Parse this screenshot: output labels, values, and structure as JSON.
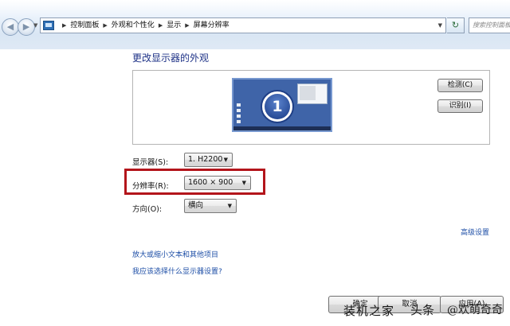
{
  "address_bar": {
    "back_icon": "back-arrow",
    "forward_icon": "forward-arrow",
    "breadcrumbs": [
      "控制面板",
      "外观和个性化",
      "显示",
      "屏幕分辨率"
    ],
    "search_placeholder": "搜索控制面板"
  },
  "main": {
    "title": "更改显示器的外观",
    "preview": {
      "monitor_number": "1",
      "detect_button": "检测(C)",
      "identify_button": "识别(I)"
    },
    "settings": {
      "display_label": "显示器(S):",
      "display_value": "1. H2200",
      "resolution_label": "分辨率(R):",
      "resolution_value": "1600 × 900",
      "orientation_label": "方向(O):",
      "orientation_value": "横向"
    },
    "advanced_link": "高级设置",
    "links": [
      "放大或缩小文本和其他项目",
      "我应该选择什么显示器设置?"
    ]
  },
  "footer": {
    "ok_button": "确定",
    "cancel_button": "取消",
    "apply_button": "应用(A)"
  },
  "watermark": {
    "text_a": "装机之家",
    "text_b": "头条",
    "text_c": "@欢萌奇奇"
  },
  "colors": {
    "highlight_border": "#b3151b",
    "link": "#1d4ea6",
    "title": "#1e3287"
  }
}
